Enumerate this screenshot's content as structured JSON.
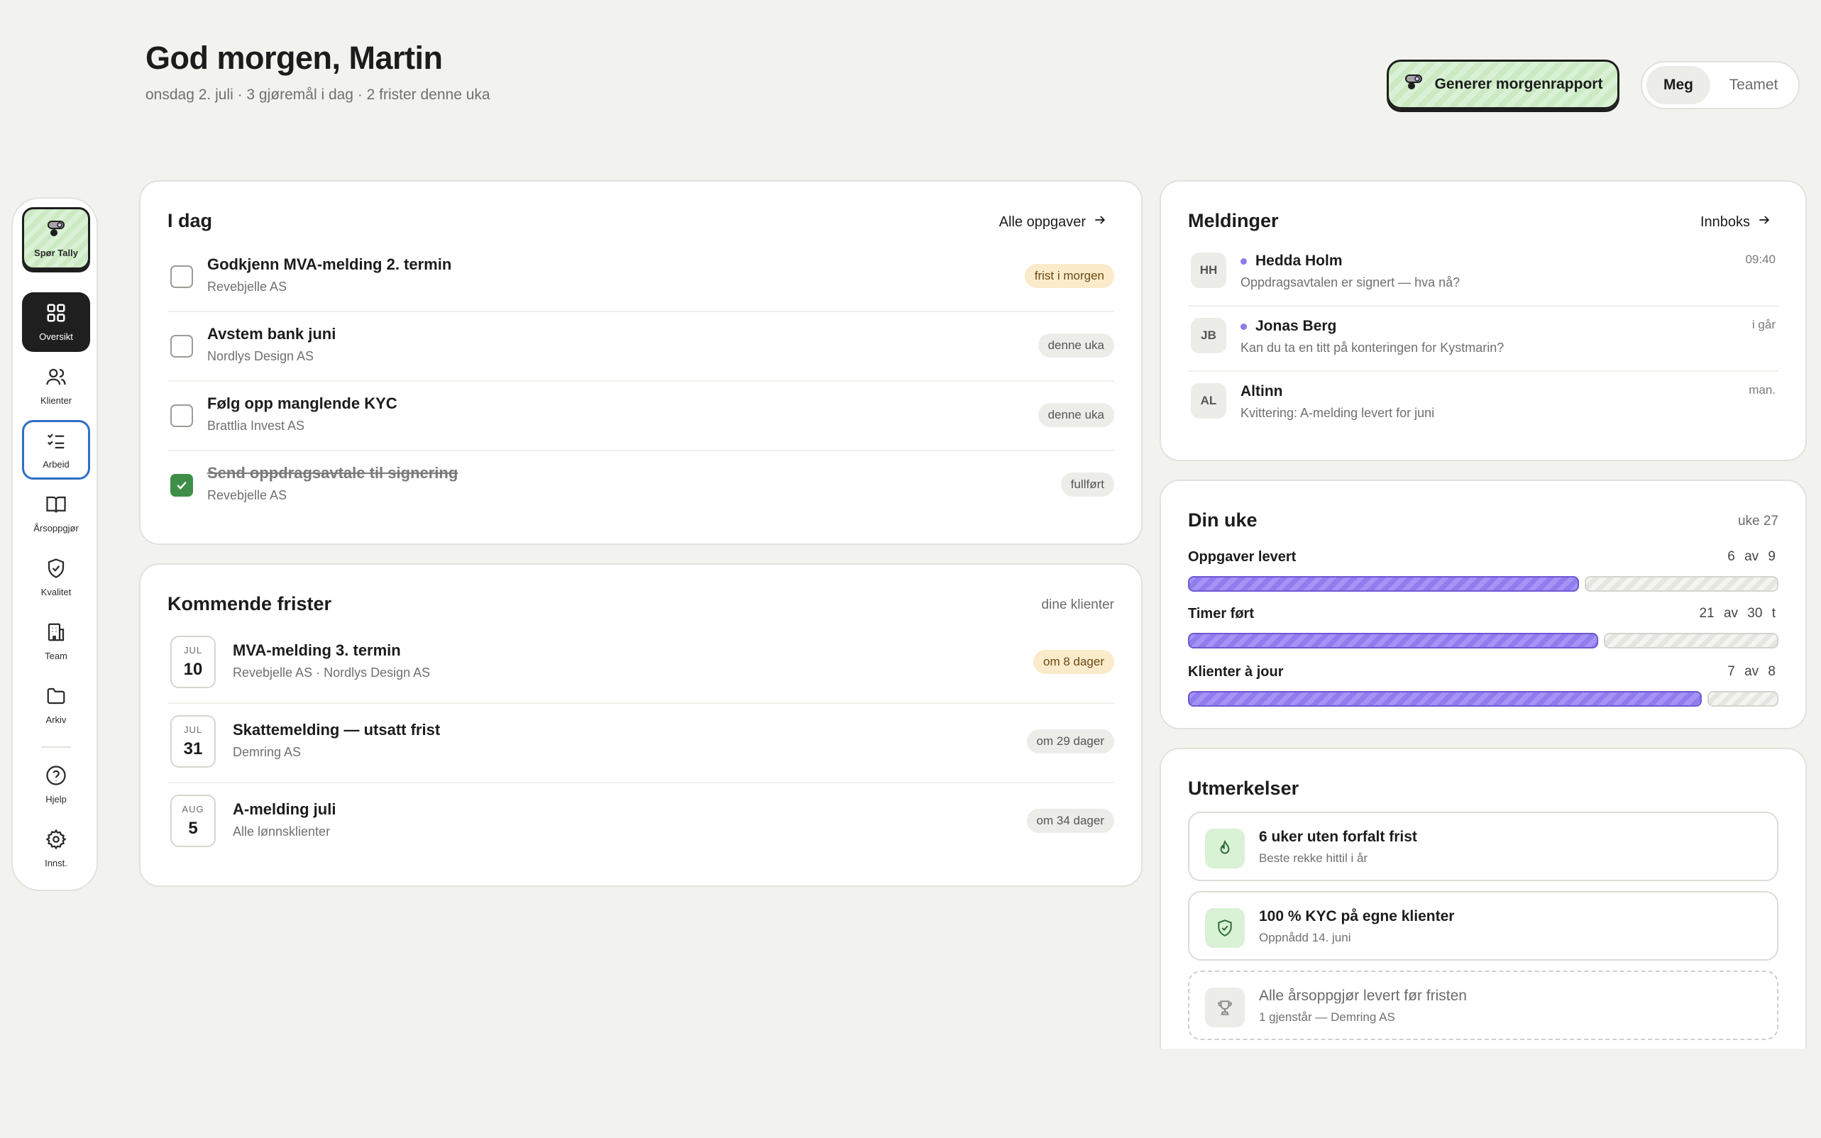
{
  "header": {
    "greeting": "God morgen, Martin",
    "subtitle": "onsdag 2. juli · 3 gjøremål i dag · 2 frister denne uka",
    "report_button": "Generer morgenrapport",
    "toggle": {
      "me": "Meg",
      "team": "Teamet",
      "selected": "Meg"
    }
  },
  "sidebar": {
    "tally": "Spør Tally",
    "items": [
      {
        "label": "Oversikt",
        "icon": "grid-icon"
      },
      {
        "label": "Klienter",
        "icon": "users-icon"
      },
      {
        "label": "Arbeid",
        "icon": "checklist-icon"
      },
      {
        "label": "Årsoppgjør",
        "icon": "book-icon"
      },
      {
        "label": "Kvalitet",
        "icon": "shield-check-icon"
      },
      {
        "label": "Team",
        "icon": "building-icon"
      },
      {
        "label": "Arkiv",
        "icon": "folder-icon"
      },
      {
        "label": "Hjelp",
        "icon": "help-icon"
      },
      {
        "label": "Innst.",
        "icon": "gear-icon"
      }
    ]
  },
  "today": {
    "title": "I dag",
    "link": "Alle oppgaver",
    "tasks": [
      {
        "title": "Godkjenn MVA-melding 2. termin",
        "client": "Revebjelle AS",
        "badge": "frist i morgen",
        "done": false
      },
      {
        "title": "Avstem bank juni",
        "client": "Nordlys Design AS",
        "badge": "denne uka",
        "done": false
      },
      {
        "title": "Følg opp manglende KYC",
        "client": "Brattlia Invest AS",
        "badge": "denne uka",
        "done": false
      },
      {
        "title": "Send oppdragsavtale til signering",
        "client": "Revebjelle AS",
        "badge": "fullført",
        "done": true
      }
    ]
  },
  "deadlines": {
    "title": "Kommende frister",
    "meta": "dine klienter",
    "items": [
      {
        "month": "JUL",
        "day": "10",
        "title": "MVA-melding 3. termin",
        "clients": "Revebjelle AS · Nordlys Design AS",
        "badge": "om 8 dager"
      },
      {
        "month": "JUL",
        "day": "31",
        "title": "Skattemelding — utsatt frist",
        "clients": "Demring AS",
        "badge": "om 29 dager"
      },
      {
        "month": "AUG",
        "day": "5",
        "title": "A-melding juli",
        "clients": "Alle lønnsklienter",
        "badge": "om 34 dager"
      }
    ]
  },
  "messages": {
    "title": "Meldinger",
    "link": "Innboks",
    "items": [
      {
        "initials": "HH",
        "name": "Hedda Holm",
        "text": "Oppdragsavtalen er signert — hva nå?",
        "time": "09:40",
        "unread": true
      },
      {
        "initials": "JB",
        "name": "Jonas Berg",
        "text": "Kan du ta en titt på konteringen for Kystmarin?",
        "time": "i går",
        "unread": true
      },
      {
        "initials": "AL",
        "name": "Altinn",
        "text": "Kvittering: A-melding levert for juni",
        "time": "man.",
        "unread": false
      }
    ]
  },
  "week": {
    "title": "Din uke",
    "meta": "uke 27",
    "stats": [
      {
        "label": "Oppgaver levert",
        "count": "6 av 9",
        "fraction": 0.667
      },
      {
        "label": "Timer ført",
        "count": "21 av 30 t",
        "fraction": 0.7
      },
      {
        "label": "Klienter à jour",
        "count": "7 av 8",
        "fraction": 0.875
      }
    ]
  },
  "awards": {
    "title": "Utmerkelser",
    "items": [
      {
        "title": "6 uker uten forfalt frist",
        "sub": "Beste rekke hittil i år",
        "icon": "flame-icon",
        "achieved": true
      },
      {
        "title": "100 % KYC på egne klienter",
        "sub": "Oppnådd 14. juni",
        "icon": "shield-check-icon",
        "achieved": true
      },
      {
        "title": "Alle årsoppgjør levert før fristen",
        "sub": "1 gjenstår — Demring AS",
        "icon": "trophy-icon",
        "achieved": false
      }
    ]
  },
  "colors": {
    "accent_green": "#cbeac4",
    "progress_purple": "#917ced",
    "check_green": "#3e8e47",
    "warn_badge": "#fbebcb",
    "focus_blue": "#2f6fc4"
  }
}
